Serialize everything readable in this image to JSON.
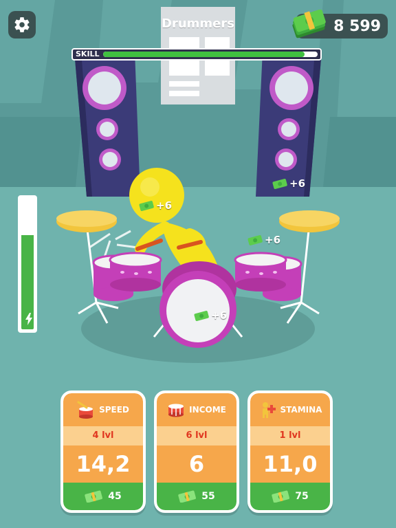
{
  "header": {
    "title": "Drummers",
    "money": "8 599",
    "settings_icon": "gear-icon",
    "money_icon": "cash-stack-icon"
  },
  "skill": {
    "label": "SKILL",
    "progress": 0.94
  },
  "stamina": {
    "level": 0.72,
    "icon": "lightning-bolt-icon"
  },
  "popups": [
    {
      "text": "+6"
    },
    {
      "text": "+6"
    },
    {
      "text": "+6"
    },
    {
      "text": "+6"
    }
  ],
  "upgrades": [
    {
      "name": "SPEED",
      "level": "4 lvl",
      "value": "14,2",
      "cost": "45",
      "icon": "drum-speed-icon"
    },
    {
      "name": "INCOME",
      "level": "6 lvl",
      "value": "6",
      "cost": "55",
      "icon": "snare-drum-icon"
    },
    {
      "name": "STAMINA",
      "level": "1 lvl",
      "value": "11,0",
      "cost": "75",
      "icon": "stamina-person-icon"
    }
  ],
  "colors": {
    "floor": "#6fb3ad",
    "wall": "#5a9a98",
    "speaker": "#3b3b78",
    "speaker_ring": "#c05ac8",
    "drum": "#c43fb8",
    "cymbal": "#f2c53c",
    "character": "#f5e21d",
    "card_orange": "#f6a74b",
    "card_green": "#49b447",
    "level_red": "#e0361f"
  }
}
